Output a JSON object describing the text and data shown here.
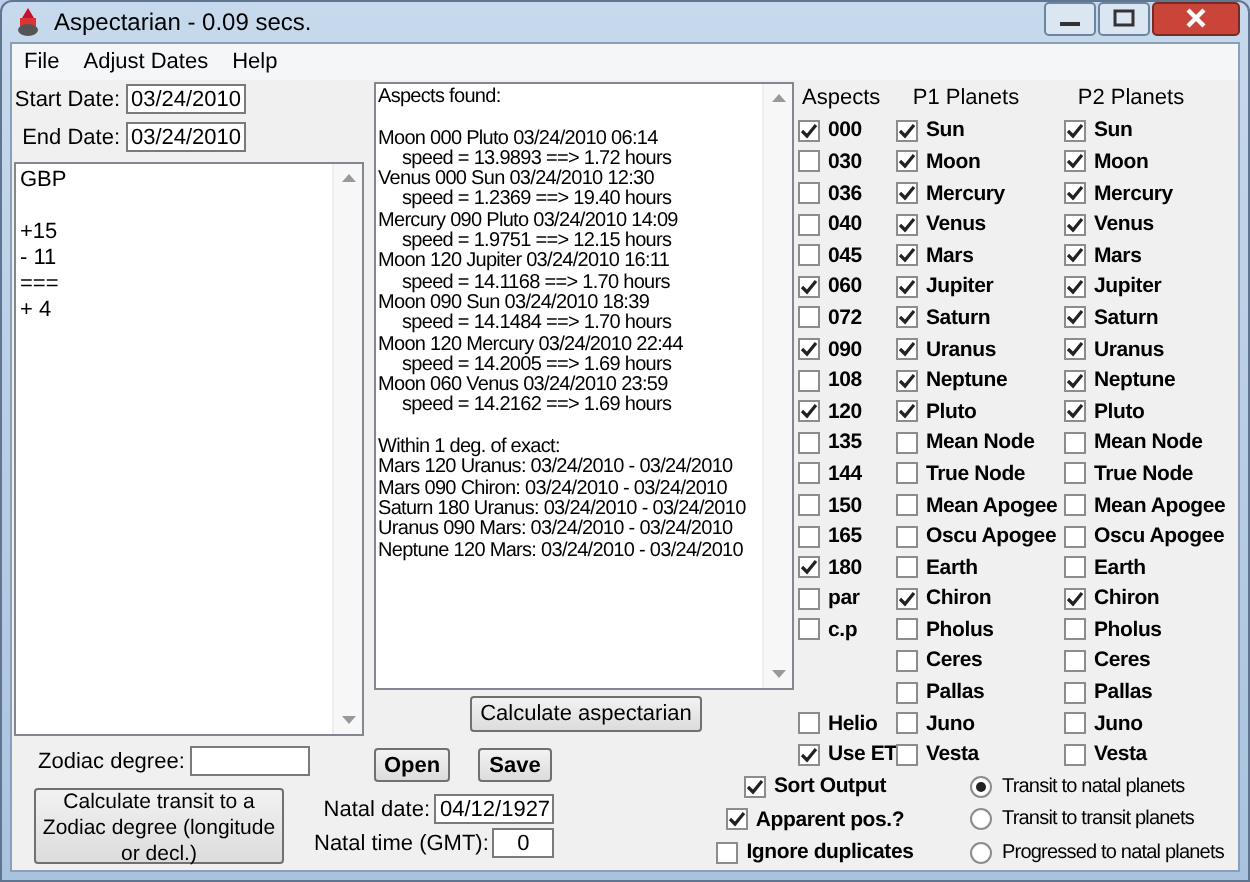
{
  "window": {
    "title": "Aspectarian - 0.09 secs."
  },
  "menu": [
    "File",
    "Adjust Dates",
    "Help"
  ],
  "start_date": {
    "label": "Start Date:",
    "value": "03/24/2010"
  },
  "end_date": {
    "label": "End Date:",
    "value": "03/24/2010"
  },
  "currency_list": {
    "groups": [
      [
        "GBP"
      ],
      [
        "+15",
        "- 11",
        "===",
        "+ 4"
      ]
    ]
  },
  "zodiac_degree": {
    "label": "Zodiac degree:"
  },
  "transit_button": "Calculate transit to a Zodiac degree (longitude or decl.)",
  "output": {
    "heading": "Aspects found:",
    "aspects": [
      {
        "line": "Moon 000 Pluto 03/24/2010 06:14",
        "speed": "speed = 13.9893 ==> 1.72 hours"
      },
      {
        "line": "Venus 000 Sun 03/24/2010 12:30",
        "speed": "speed = 1.2369 ==> 19.40 hours"
      },
      {
        "line": "Mercury 090 Pluto 03/24/2010 14:09",
        "speed": "speed = 1.9751 ==> 12.15 hours"
      },
      {
        "line": "Moon 120 Jupiter 03/24/2010 16:11",
        "speed": "speed = 14.1168 ==> 1.70 hours"
      },
      {
        "line": "Moon 090 Sun 03/24/2010 18:39",
        "speed": "speed = 14.1484 ==> 1.70 hours"
      },
      {
        "line": "Moon 120 Mercury 03/24/2010 22:44",
        "speed": "speed = 14.2005 ==> 1.69 hours"
      },
      {
        "line": "Moon 060 Venus 03/24/2010 23:59",
        "speed": "speed = 14.2162 ==> 1.69 hours"
      }
    ],
    "exact_heading": "Within 1 deg. of exact:",
    "exact": [
      "Mars 120 Uranus: 03/24/2010 - 03/24/2010",
      "Mars 090 Chiron: 03/24/2010 - 03/24/2010",
      "Saturn 180 Uranus: 03/24/2010 - 03/24/2010",
      "Uranus 090 Mars: 03/24/2010 - 03/24/2010",
      "Neptune 120 Mars: 03/24/2010 - 03/24/2010"
    ]
  },
  "calculate_button": "Calculate aspectarian",
  "open_button": "Open",
  "save_button": "Save",
  "natal_date": {
    "label": "Natal date:",
    "value": "04/12/1927"
  },
  "natal_time": {
    "label": "Natal time (GMT):",
    "value": "0"
  },
  "columns": {
    "aspects": "Aspects",
    "p1": "P1 Planets",
    "p2": "P2 Planets"
  },
  "aspects": [
    {
      "label": "000",
      "checked": true
    },
    {
      "label": "030",
      "checked": false
    },
    {
      "label": "036",
      "checked": false
    },
    {
      "label": "040",
      "checked": false
    },
    {
      "label": "045",
      "checked": false
    },
    {
      "label": "060",
      "checked": true
    },
    {
      "label": "072",
      "checked": false
    },
    {
      "label": "090",
      "checked": true
    },
    {
      "label": "108",
      "checked": false
    },
    {
      "label": "120",
      "checked": true
    },
    {
      "label": "135",
      "checked": false
    },
    {
      "label": "144",
      "checked": false
    },
    {
      "label": "150",
      "checked": false
    },
    {
      "label": "165",
      "checked": false
    },
    {
      "label": "180",
      "checked": true
    },
    {
      "label": "par",
      "checked": false
    },
    {
      "label": "c.p",
      "checked": false
    }
  ],
  "side_options": [
    {
      "label": "Helio",
      "checked": false
    },
    {
      "label": "Use ET",
      "checked": true
    }
  ],
  "p1_planets": [
    {
      "label": "Sun",
      "checked": true
    },
    {
      "label": "Moon",
      "checked": true
    },
    {
      "label": "Mercury",
      "checked": true
    },
    {
      "label": "Venus",
      "checked": true
    },
    {
      "label": "Mars",
      "checked": true
    },
    {
      "label": "Jupiter",
      "checked": true
    },
    {
      "label": "Saturn",
      "checked": true
    },
    {
      "label": "Uranus",
      "checked": true
    },
    {
      "label": "Neptune",
      "checked": true
    },
    {
      "label": "Pluto",
      "checked": true
    },
    {
      "label": "Mean Node",
      "checked": false
    },
    {
      "label": "True Node",
      "checked": false
    },
    {
      "label": "Mean Apogee",
      "checked": false
    },
    {
      "label": "Oscu Apogee",
      "checked": false
    },
    {
      "label": "Earth",
      "checked": false
    },
    {
      "label": "Chiron",
      "checked": true
    },
    {
      "label": "Pholus",
      "checked": false
    },
    {
      "label": "Ceres",
      "checked": false
    },
    {
      "label": "Pallas",
      "checked": false
    },
    {
      "label": "Juno",
      "checked": false
    },
    {
      "label": "Vesta",
      "checked": false
    }
  ],
  "p2_planets": [
    {
      "label": "Sun",
      "checked": true
    },
    {
      "label": "Moon",
      "checked": true
    },
    {
      "label": "Mercury",
      "checked": true
    },
    {
      "label": "Venus",
      "checked": true
    },
    {
      "label": "Mars",
      "checked": true
    },
    {
      "label": "Jupiter",
      "checked": true
    },
    {
      "label": "Saturn",
      "checked": true
    },
    {
      "label": "Uranus",
      "checked": true
    },
    {
      "label": "Neptune",
      "checked": true
    },
    {
      "label": "Pluto",
      "checked": true
    },
    {
      "label": "Mean Node",
      "checked": false
    },
    {
      "label": "True Node",
      "checked": false
    },
    {
      "label": "Mean Apogee",
      "checked": false
    },
    {
      "label": "Oscu Apogee",
      "checked": false
    },
    {
      "label": "Earth",
      "checked": false
    },
    {
      "label": "Chiron",
      "checked": true
    },
    {
      "label": "Pholus",
      "checked": false
    },
    {
      "label": "Ceres",
      "checked": false
    },
    {
      "label": "Pallas",
      "checked": false
    },
    {
      "label": "Juno",
      "checked": false
    },
    {
      "label": "Vesta",
      "checked": false
    }
  ],
  "options": [
    {
      "label": "Sort Output",
      "checked": true
    },
    {
      "label": "Apparent pos.?",
      "checked": true
    },
    {
      "label": "Ignore duplicates",
      "checked": false
    }
  ],
  "modes": [
    {
      "label": "Transit to natal planets",
      "selected": true
    },
    {
      "label": "Transit to transit planets",
      "selected": false
    },
    {
      "label": "Progressed to natal planets",
      "selected": false
    }
  ]
}
